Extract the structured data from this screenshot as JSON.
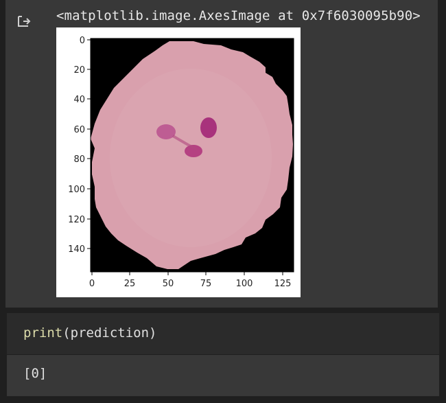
{
  "output": {
    "icon": "output-redirect-icon",
    "repr_text": "<matplotlib.image.AxesImage at 0x7f6030095b90>"
  },
  "plot": {
    "y_ticks": [
      "0",
      "20",
      "40",
      "60",
      "80",
      "100",
      "120",
      "140"
    ],
    "x_ticks": [
      "0",
      "25",
      "50",
      "75",
      "100",
      "125"
    ]
  },
  "cell": {
    "code_fn": "print",
    "code_args": "(prediction)"
  },
  "result": {
    "text": "[0]"
  },
  "colors": {
    "background": "#1f1f1f",
    "output_bg": "#383838",
    "cell_bg": "#2b2b2b",
    "cell_pink": "#d9a0ad",
    "parasite": "#b0367d"
  }
}
